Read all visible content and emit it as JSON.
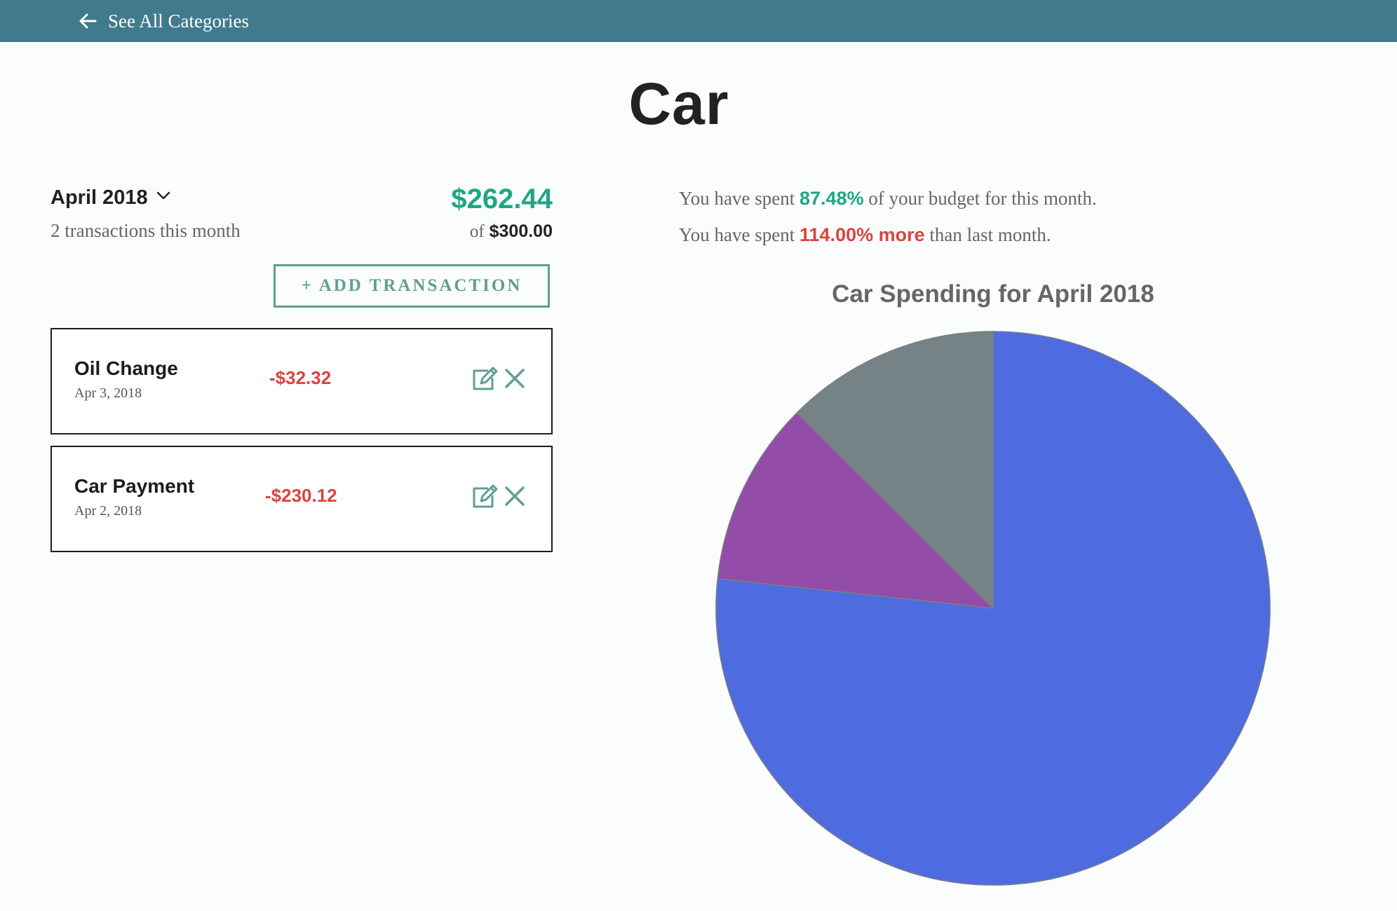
{
  "header": {
    "back_label": "See All Categories"
  },
  "page": {
    "title": "Car"
  },
  "summary": {
    "month_label": "April 2018",
    "transactions_count_text": "2 transactions this month",
    "spent": "$262.44",
    "of_label": "of",
    "budget": "$300.00",
    "add_transaction_label": "+ ADD TRANSACTION"
  },
  "transactions": [
    {
      "name": "Oil Change",
      "date": "Apr 3, 2018",
      "amount": "-$32.32"
    },
    {
      "name": "Car Payment",
      "date": "Apr 2, 2018",
      "amount": "-$230.12"
    }
  ],
  "stats": {
    "line1_prefix": "You have spent",
    "line1_value": "87.48%",
    "line1_suffix": "of your budget for this month.",
    "line2_prefix": "You have spent",
    "line2_value": "114.00% more",
    "line2_suffix": "than last month."
  },
  "colors": {
    "header_bg": "#417a8c",
    "positive": "#1ea785",
    "negative": "#d9443f",
    "accent_outline": "#5f9e96"
  },
  "icons": {
    "back": "arrow-left-icon",
    "dropdown": "chevron-down-icon",
    "edit": "edit-icon",
    "delete": "close-icon"
  },
  "chart_data": {
    "type": "pie",
    "title": "Car Spending for April 2018",
    "slices": [
      {
        "value": 230.12,
        "color": "#4e6be0"
      },
      {
        "value": 32.32,
        "color": "#944ca9"
      },
      {
        "value": 37.56,
        "color": "#758387"
      }
    ],
    "total": 300.0,
    "start_angle_deg": 0,
    "direction": "clockwise"
  }
}
